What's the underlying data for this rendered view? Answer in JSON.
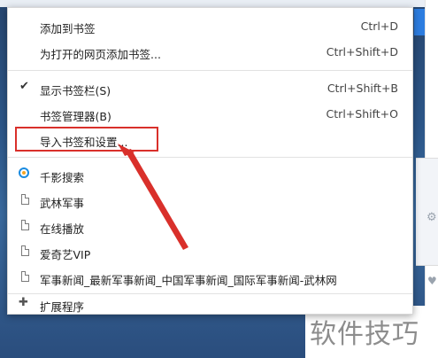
{
  "menu": {
    "items": [
      {
        "label": "添加到书签",
        "shortcut": "Ctrl+D"
      },
      {
        "label": "为打开的网页添加书签...",
        "shortcut": "Ctrl+Shift+D"
      },
      {
        "label": "显示书签栏(S)",
        "shortcut": "Ctrl+Shift+B",
        "checked": true
      },
      {
        "label": "书签管理器(B)",
        "shortcut": "Ctrl+Shift+O"
      },
      {
        "label": "导入书签和设置...",
        "shortcut": ""
      },
      {
        "label": "千影搜索",
        "icon": "search-engine-icon"
      },
      {
        "label": "武林军事",
        "icon": "page-icon"
      },
      {
        "label": "在线播放",
        "icon": "page-icon"
      },
      {
        "label": "爱奇艺VIP",
        "icon": "page-icon"
      },
      {
        "label": "军事新闻_最新军事新闻_中国军事新闻_国际军事新闻-武林网",
        "icon": "page-icon"
      },
      {
        "label": "扩展程序",
        "icon": "puzzle-icon"
      }
    ]
  },
  "watermark": "软件技巧",
  "colors": {
    "annotation": "#d9302b",
    "menu_bg": "#ffffff"
  }
}
